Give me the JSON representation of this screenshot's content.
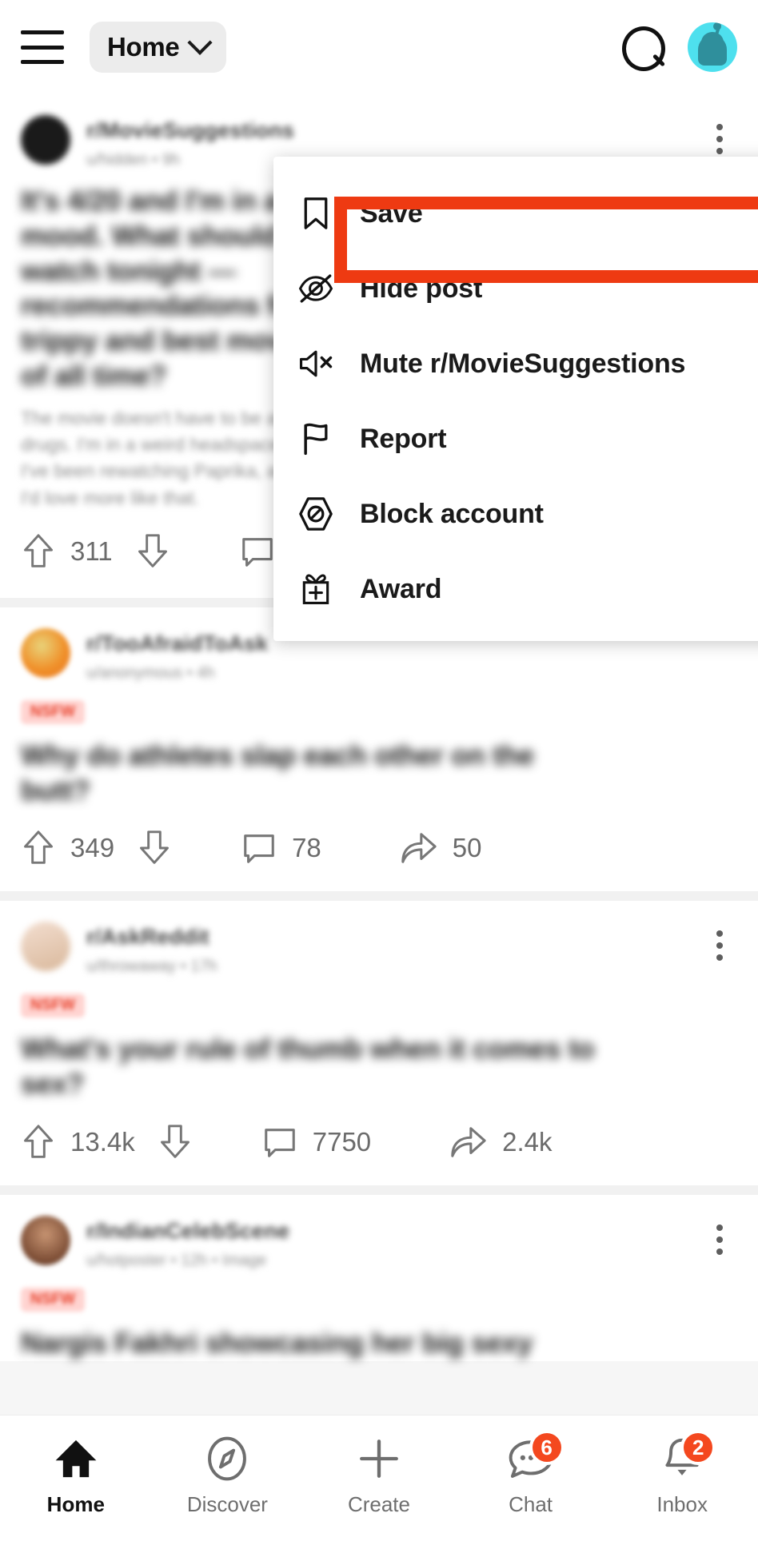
{
  "topbar": {
    "menu_icon": "hamburger-icon",
    "home_label": "Home",
    "chevron_icon": "chevron-down-icon",
    "search_icon": "search-icon",
    "avatar_icon": "user-avatar"
  },
  "context_menu": {
    "highlighted_index": 0,
    "highlight_color": "#ee3a12",
    "items": [
      {
        "label": "Save",
        "icon": "bookmark-icon"
      },
      {
        "label": "Hide post",
        "icon": "eye-off-icon"
      },
      {
        "label": "Mute r/MovieSuggestions",
        "icon": "mute-icon"
      },
      {
        "label": "Report",
        "icon": "flag-icon"
      },
      {
        "label": "Block account",
        "icon": "block-icon"
      },
      {
        "label": "Award",
        "icon": "gift-icon"
      }
    ]
  },
  "feed": {
    "posts": [
      {
        "subreddit": "r/MovieSuggestions",
        "meta": "u/hidden • 9h",
        "nsfw_badge": "",
        "title": "It's 4/20 and I'm in a mood. What should I watch tonight — recommendations for trippy and best movies of all time?",
        "body": "The movie doesn't have to be about drugs. I'm in a weird headspace. I've been rewatching Paprika, and I'd love more like that.",
        "avatar_color": "#1a1a1a",
        "upvotes": "311",
        "comments": "",
        "shares": "",
        "show_share": false
      },
      {
        "subreddit": "r/TooAfraidToAsk",
        "meta": "u/anonymous • 4h",
        "nsfw_badge": "NSFW",
        "title": "Why do athletes slap each other on the butt?",
        "body": "",
        "avatar_color": "#f0902a",
        "upvotes": "349",
        "comments": "78",
        "shares": "50",
        "show_share": true
      },
      {
        "subreddit": "r/AskReddit",
        "meta": "u/throwaway • 17h",
        "nsfw_badge": "NSFW",
        "title": "What's your rule of thumb when it comes to sex?",
        "body": "",
        "avatar_color": "#e8c7a8",
        "upvotes": "13.4k",
        "comments": "7750",
        "shares": "2.4k",
        "show_share": true
      },
      {
        "subreddit": "r/IndianCelebScene",
        "meta": "u/hotposter • 12h • Image",
        "nsfw_badge": "NSFW",
        "title": "Nargis Fakhri showcasing her big sexy",
        "body": "",
        "avatar_color": "#7a4b33",
        "upvotes": "",
        "comments": "",
        "shares": "",
        "show_share": false
      }
    ]
  },
  "bottom_nav": {
    "items": [
      {
        "label": "Home",
        "icon": "home-icon",
        "badge": "",
        "active": true
      },
      {
        "label": "Discover",
        "icon": "compass-icon",
        "badge": "",
        "active": false
      },
      {
        "label": "Create",
        "icon": "plus-icon",
        "badge": "",
        "active": false
      },
      {
        "label": "Chat",
        "icon": "chat-icon",
        "badge": "6",
        "active": false
      },
      {
        "label": "Inbox",
        "icon": "bell-icon",
        "badge": "2",
        "active": false
      }
    ],
    "badge_color": "#f4481f"
  }
}
